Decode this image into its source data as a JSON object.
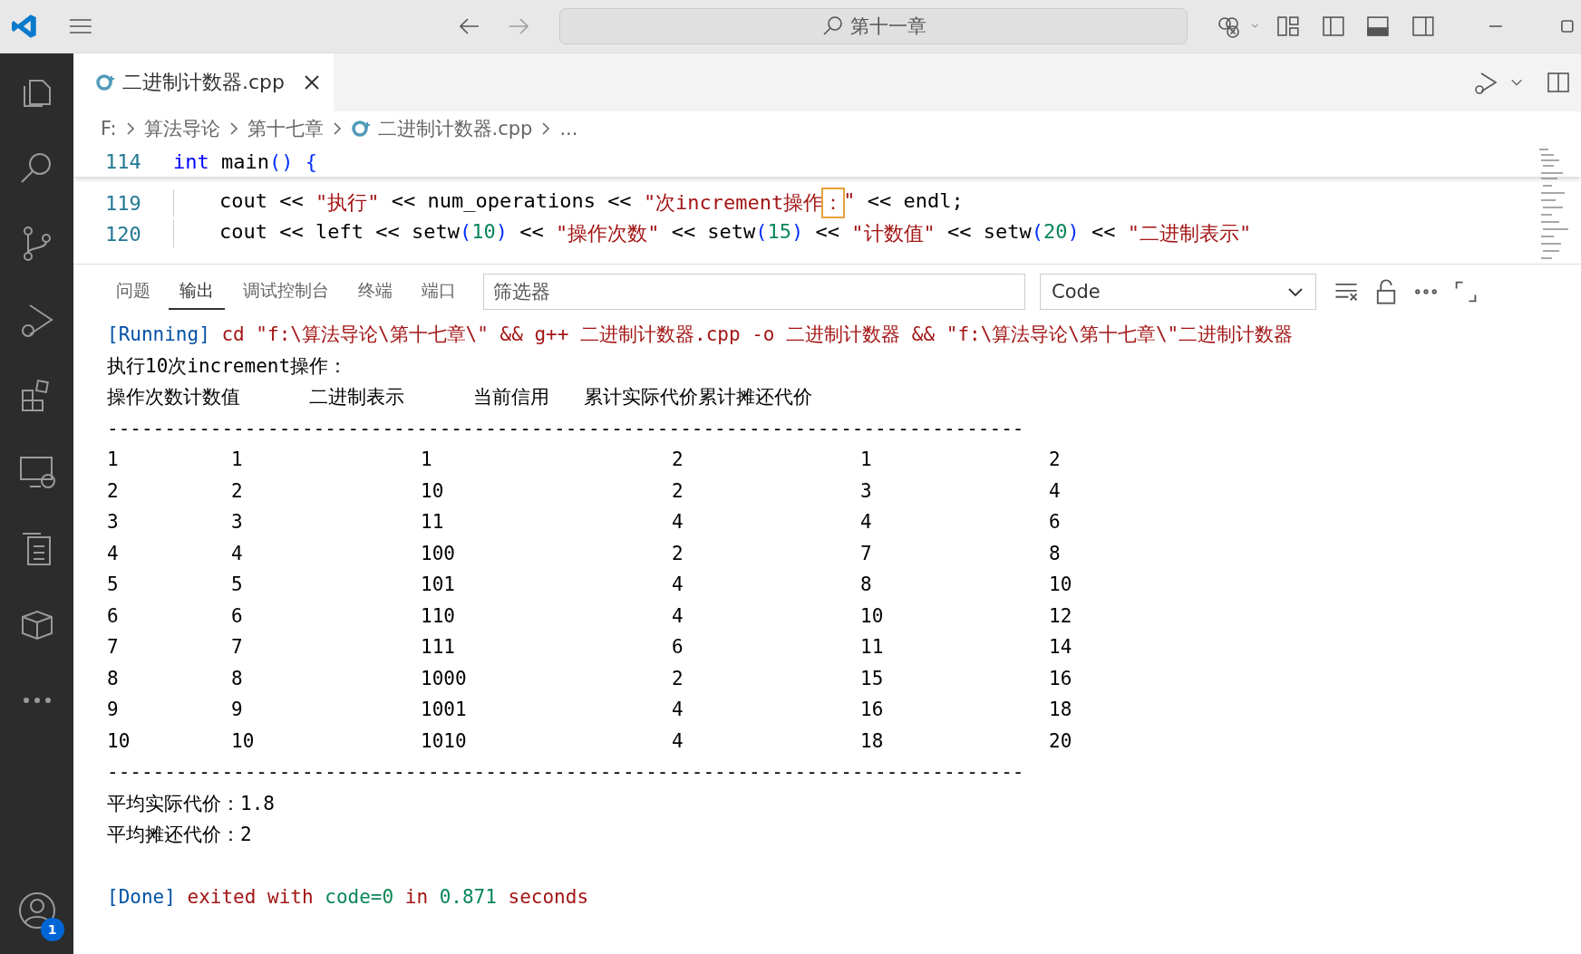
{
  "title_bar": {
    "search": "第十一章"
  },
  "activity_bar": {
    "account_badge": "1"
  },
  "tabs": [
    {
      "label": "二进制计数器.cpp",
      "selected": true
    }
  ],
  "breadcrumb": [
    "F:",
    "算法导论",
    "第十七章",
    "二进制计数器.cpp",
    "..."
  ],
  "editor": {
    "lines": [
      {
        "number": "114",
        "sticky": true,
        "tokens": [
          {
            "kind": "keyword",
            "text": "int"
          },
          {
            "kind": "plain",
            "text": " main"
          },
          {
            "kind": "paren",
            "text": "() {"
          }
        ],
        "children": [
          {
            "number": "119",
            "sticky": false,
            "tokens": [
              {
                "kind": "plain",
                "text": "cout << "
              },
              {
                "kind": "string",
                "text": "\"执行\""
              },
              {
                "kind": "plain",
                "text": " << num_operations << "
              },
              {
                "kind": "string",
                "text": "\"次increment操作"
              },
              {
                "kind": "highlight",
                "text": "："
              },
              {
                "kind": "string",
                "text": "\""
              },
              {
                "kind": "plain",
                "text": " << endl;"
              }
            ]
          },
          {
            "number": "120",
            "sticky": false,
            "tokens": [
              {
                "kind": "plain",
                "text": "cout << left << setw"
              },
              {
                "kind": "paren",
                "text": "("
              },
              {
                "kind": "number",
                "text": "10"
              },
              {
                "kind": "paren",
                "text": ")"
              },
              {
                "kind": "plain",
                "text": " << "
              },
              {
                "kind": "string",
                "text": "\"操作次数\""
              },
              {
                "kind": "plain",
                "text": " << setw"
              },
              {
                "kind": "paren",
                "text": "("
              },
              {
                "kind": "number",
                "text": "15"
              },
              {
                "kind": "paren",
                "text": ")"
              },
              {
                "kind": "plain",
                "text": " << "
              },
              {
                "kind": "string",
                "text": "\"计数值\""
              },
              {
                "kind": "plain",
                "text": " << setw"
              },
              {
                "kind": "paren",
                "text": "("
              },
              {
                "kind": "number",
                "text": "20"
              },
              {
                "kind": "paren",
                "text": ")"
              },
              {
                "kind": "plain",
                "text": " << "
              },
              {
                "kind": "string",
                "text": "\"二进制表示\""
              }
            ]
          }
        ]
      }
    ]
  },
  "panel": {
    "tabs": [
      {
        "label": "问题",
        "selected": false
      },
      {
        "label": "输出",
        "selected": true
      },
      {
        "label": "调试控制台",
        "selected": false
      },
      {
        "label": "终端",
        "selected": false
      },
      {
        "label": "端口",
        "selected": false
      }
    ],
    "filter": {
      "placeholder": "筛选器"
    },
    "channel": "Code",
    "output": [
      {
        "kind": "parts",
        "parts": [
          {
            "kind": "tag",
            "text": "[Running]"
          },
          {
            "kind": "command",
            "text": " cd \"f:\\算法导论\\第十七章\\\" && g++ 二进制计数器.cpp -o 二进制计数器 && \"f:\\算法导论\\第十七章\\\"二进制计数器"
          }
        ]
      },
      {
        "kind": "text",
        "text": "执行10次increment操作："
      },
      {
        "kind": "text",
        "text": "操作次数计数值      二进制表示      当前信用   累计实际代价累计摊还代价"
      },
      {
        "kind": "text",
        "text": "--------------------------------------------------------------------------------"
      },
      {
        "kind": "row",
        "cells": [
          "1",
          "1",
          "1",
          "2",
          "1",
          "2"
        ]
      },
      {
        "kind": "row",
        "cells": [
          "2",
          "2",
          "10",
          "2",
          "3",
          "4"
        ]
      },
      {
        "kind": "row",
        "cells": [
          "3",
          "3",
          "11",
          "4",
          "4",
          "6"
        ]
      },
      {
        "kind": "row",
        "cells": [
          "4",
          "4",
          "100",
          "2",
          "7",
          "8"
        ]
      },
      {
        "kind": "row",
        "cells": [
          "5",
          "5",
          "101",
          "4",
          "8",
          "10"
        ]
      },
      {
        "kind": "row",
        "cells": [
          "6",
          "6",
          "110",
          "4",
          "10",
          "12"
        ]
      },
      {
        "kind": "row",
        "cells": [
          "7",
          "7",
          "111",
          "6",
          "11",
          "14"
        ]
      },
      {
        "kind": "row",
        "cells": [
          "8",
          "8",
          "1000",
          "2",
          "15",
          "16"
        ]
      },
      {
        "kind": "row",
        "cells": [
          "9",
          "9",
          "1001",
          "4",
          "16",
          "18"
        ]
      },
      {
        "kind": "row",
        "cells": [
          "10",
          "10",
          "1010",
          "4",
          "18",
          "20"
        ]
      },
      {
        "kind": "text",
        "text": "--------------------------------------------------------------------------------"
      },
      {
        "kind": "text",
        "text": "平均实际代价：1.8"
      },
      {
        "kind": "text",
        "text": "平均摊还代价：2"
      },
      {
        "kind": "blank"
      },
      {
        "kind": "parts",
        "parts": [
          {
            "kind": "tag",
            "text": "[Done]"
          },
          {
            "kind": "command",
            "text": " exited with "
          },
          {
            "kind": "ok",
            "text": "code=0"
          },
          {
            "kind": "command",
            "text": " in "
          },
          {
            "kind": "ok",
            "text": "0.871"
          },
          {
            "kind": "command",
            "text": " seconds"
          }
        ]
      }
    ]
  }
}
